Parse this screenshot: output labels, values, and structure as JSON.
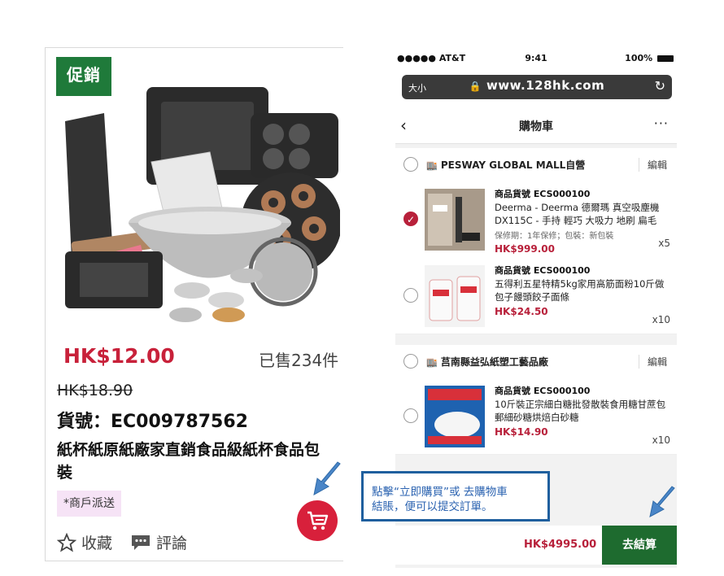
{
  "product_card": {
    "promo_tag": "促銷",
    "price": "HK$12.00",
    "sold_count": "已售234件",
    "original_price": "HK$18.90",
    "sku": "貨號：EC009787562",
    "name": "紙杯紙原紙廠家直銷食品級紙杯食品包裝",
    "merchant_tag": "*商戶派送",
    "favorite_label": "收藏",
    "comment_label": "評論",
    "icons": [
      "star-icon",
      "comment-icon",
      "cart-icon"
    ]
  },
  "phone": {
    "status_bar": {
      "carrier": "●●●●● AT&T",
      "time": "9:41",
      "battery": "100%"
    },
    "browser": {
      "text_size": "大小",
      "url": "www.128hk.com"
    },
    "nav": {
      "back": "‹",
      "title": "購物車",
      "more": "···"
    },
    "stores": [
      {
        "name": "PESWAY GLOBAL MALL自營",
        "edit": "編輯",
        "items": [
          {
            "code": "商品貨號  ECS000100",
            "desc": "Deerma - Deerma 德爾瑪 真空吸塵機 DX115C - 手持 輕巧 大吸力 地刷 扁毛",
            "warranty": "保修期：1年保修；包裝：新包裝",
            "price": "HK$999.00",
            "qty": "x5",
            "checked": true
          },
          {
            "code": "商品貨號  ECS000100",
            "desc": "五得利五星特精5kg家用高筋面粉10斤做包子饅頭餃子面條",
            "warranty": "",
            "price": "HK$24.50",
            "qty": "x10",
            "checked": false
          }
        ]
      },
      {
        "name": "莒南縣益弘紙塑工藝品廠",
        "edit": "編輯",
        "items": [
          {
            "code": "商品貨號  ECS000100",
            "desc": "10斤裝正宗細白糖批發散裝食用糖甘蔗包郵細砂糖烘焙白砂糖",
            "warranty": "",
            "price": "HK$14.90",
            "qty": "x10",
            "checked": false
          }
        ]
      }
    ],
    "checkout": {
      "total": "HK$4995.00",
      "button": "去結算"
    }
  },
  "callout": {
    "line1": "點擊“立即購買”或 去購物車",
    "line2": "結賬，便可以提交訂單。"
  },
  "colors": {
    "accent_red": "#c8213a",
    "brand_green": "#1e6b2f",
    "callout_blue": "#1f5f9e"
  }
}
